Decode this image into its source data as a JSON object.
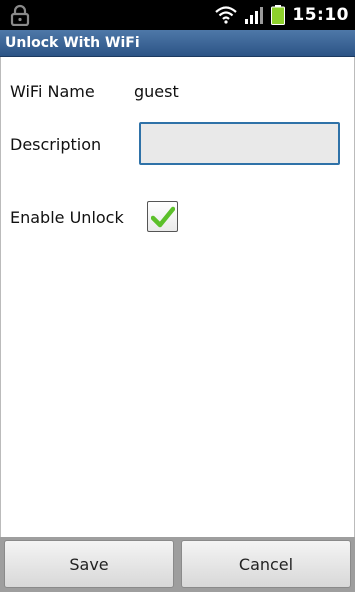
{
  "status_bar": {
    "time": "15:10",
    "icons": [
      "lock-icon",
      "wifi-icon",
      "signal-icon",
      "battery-icon"
    ]
  },
  "title_bar": {
    "title": "Unlock With WiFi"
  },
  "form": {
    "wifi_name_label": "WiFi Name",
    "wifi_name_value": "guest",
    "description_label": "Description",
    "description_value": "",
    "enable_unlock_label": "Enable Unlock",
    "enable_unlock_checked": true
  },
  "buttons": {
    "save_label": "Save",
    "cancel_label": "Cancel"
  },
  "colors": {
    "title_bar": "#3a6597",
    "input_border": "#2f72a8",
    "check": "#5cc02a",
    "battery": "#8ed12c"
  }
}
